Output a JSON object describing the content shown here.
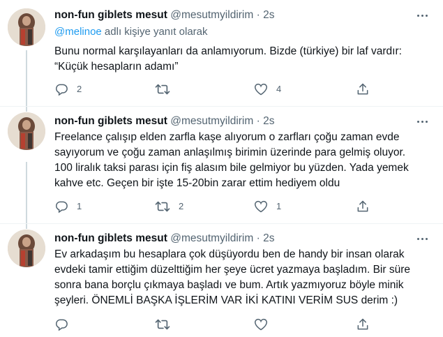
{
  "tweets": [
    {
      "name": "non-fun giblets mesut",
      "handle": "@mesutmyildirim",
      "separator": "·",
      "time": "2s",
      "reply_handle": "@melinoe",
      "reply_suffix": " adlı kişiye yanıt olarak",
      "lines": [
        "Bunu normal karşılayanları da anlamıyorum. Bizde (türkiye) bir laf vardır:",
        "“Küçük hesapların adamı”"
      ],
      "replies": "2",
      "retweets": "",
      "likes": "4"
    },
    {
      "name": "non-fun giblets mesut",
      "handle": "@mesutmyildirim",
      "separator": "·",
      "time": "2s",
      "lines": [
        "Freelance çalışıp elden zarfla kaşe alıyorum o zarfları çoğu zaman evde",
        "sayıyorum ve çoğu zaman anlaşılmış birimin üzerinde para gelmiş oluyor.",
        "100 liralık taksi parası için fiş alasım bile gelmiyor bu yüzden. Yada yemek",
        "kahve etc. Geçen bir işte 15-20bin zarar ettim hediyem oldu"
      ],
      "replies": "1",
      "retweets": "2",
      "likes": "1"
    },
    {
      "name": "non-fun giblets mesut",
      "handle": "@mesutmyildirim",
      "separator": "·",
      "time": "2s",
      "lines": [
        "Ev arkadaşım bu hesaplara çok düşüyordu ben de handy bir insan olarak",
        "evdeki tamir ettiğim düzelttiğim her şeye ücret yazmaya başladım. Bir süre",
        "sonra bana borçlu çıkmaya başladı ve bum. Artık yazmıyoruz böyle minik",
        "şeyleri. ÖNEMLİ BAŞKA İŞLERİM VAR İKİ KATINI VERİM SUS derim :)"
      ],
      "replies": "",
      "retweets": "",
      "likes": ""
    }
  ],
  "icons": {
    "reply": "reply-icon",
    "retweet": "retweet-icon",
    "like": "heart-icon",
    "share": "share-icon",
    "more": "more-icon"
  },
  "colors": {
    "link": "#1d9bf0",
    "secondary": "#536471",
    "text": "#0f1419",
    "thread_line": "#cfd9de"
  }
}
